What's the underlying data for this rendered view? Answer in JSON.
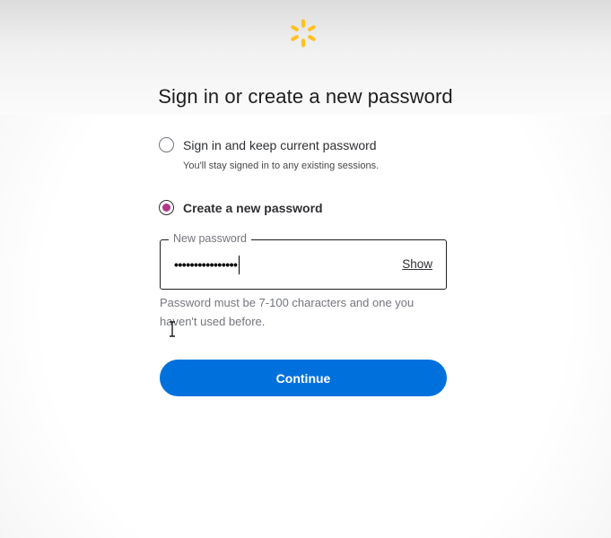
{
  "page": {
    "title": "Sign in or create a new password"
  },
  "logo": {
    "icon": "walmart-spark-icon",
    "color": "#ffc220"
  },
  "options": [
    {
      "label": "Sign in and keep current password",
      "description": "You'll stay signed in to any existing sessions.",
      "checked": false
    },
    {
      "label": "Create a new password",
      "checked": true
    }
  ],
  "password_field": {
    "legend": "New password",
    "value": "••••••••••••••••",
    "show_label": "Show"
  },
  "helper_text": "Password must be 7-100 characters and one you haven't used before.",
  "continue_label": "Continue",
  "colors": {
    "primary": "#0071dc",
    "radio_selected": "#b3358a"
  }
}
